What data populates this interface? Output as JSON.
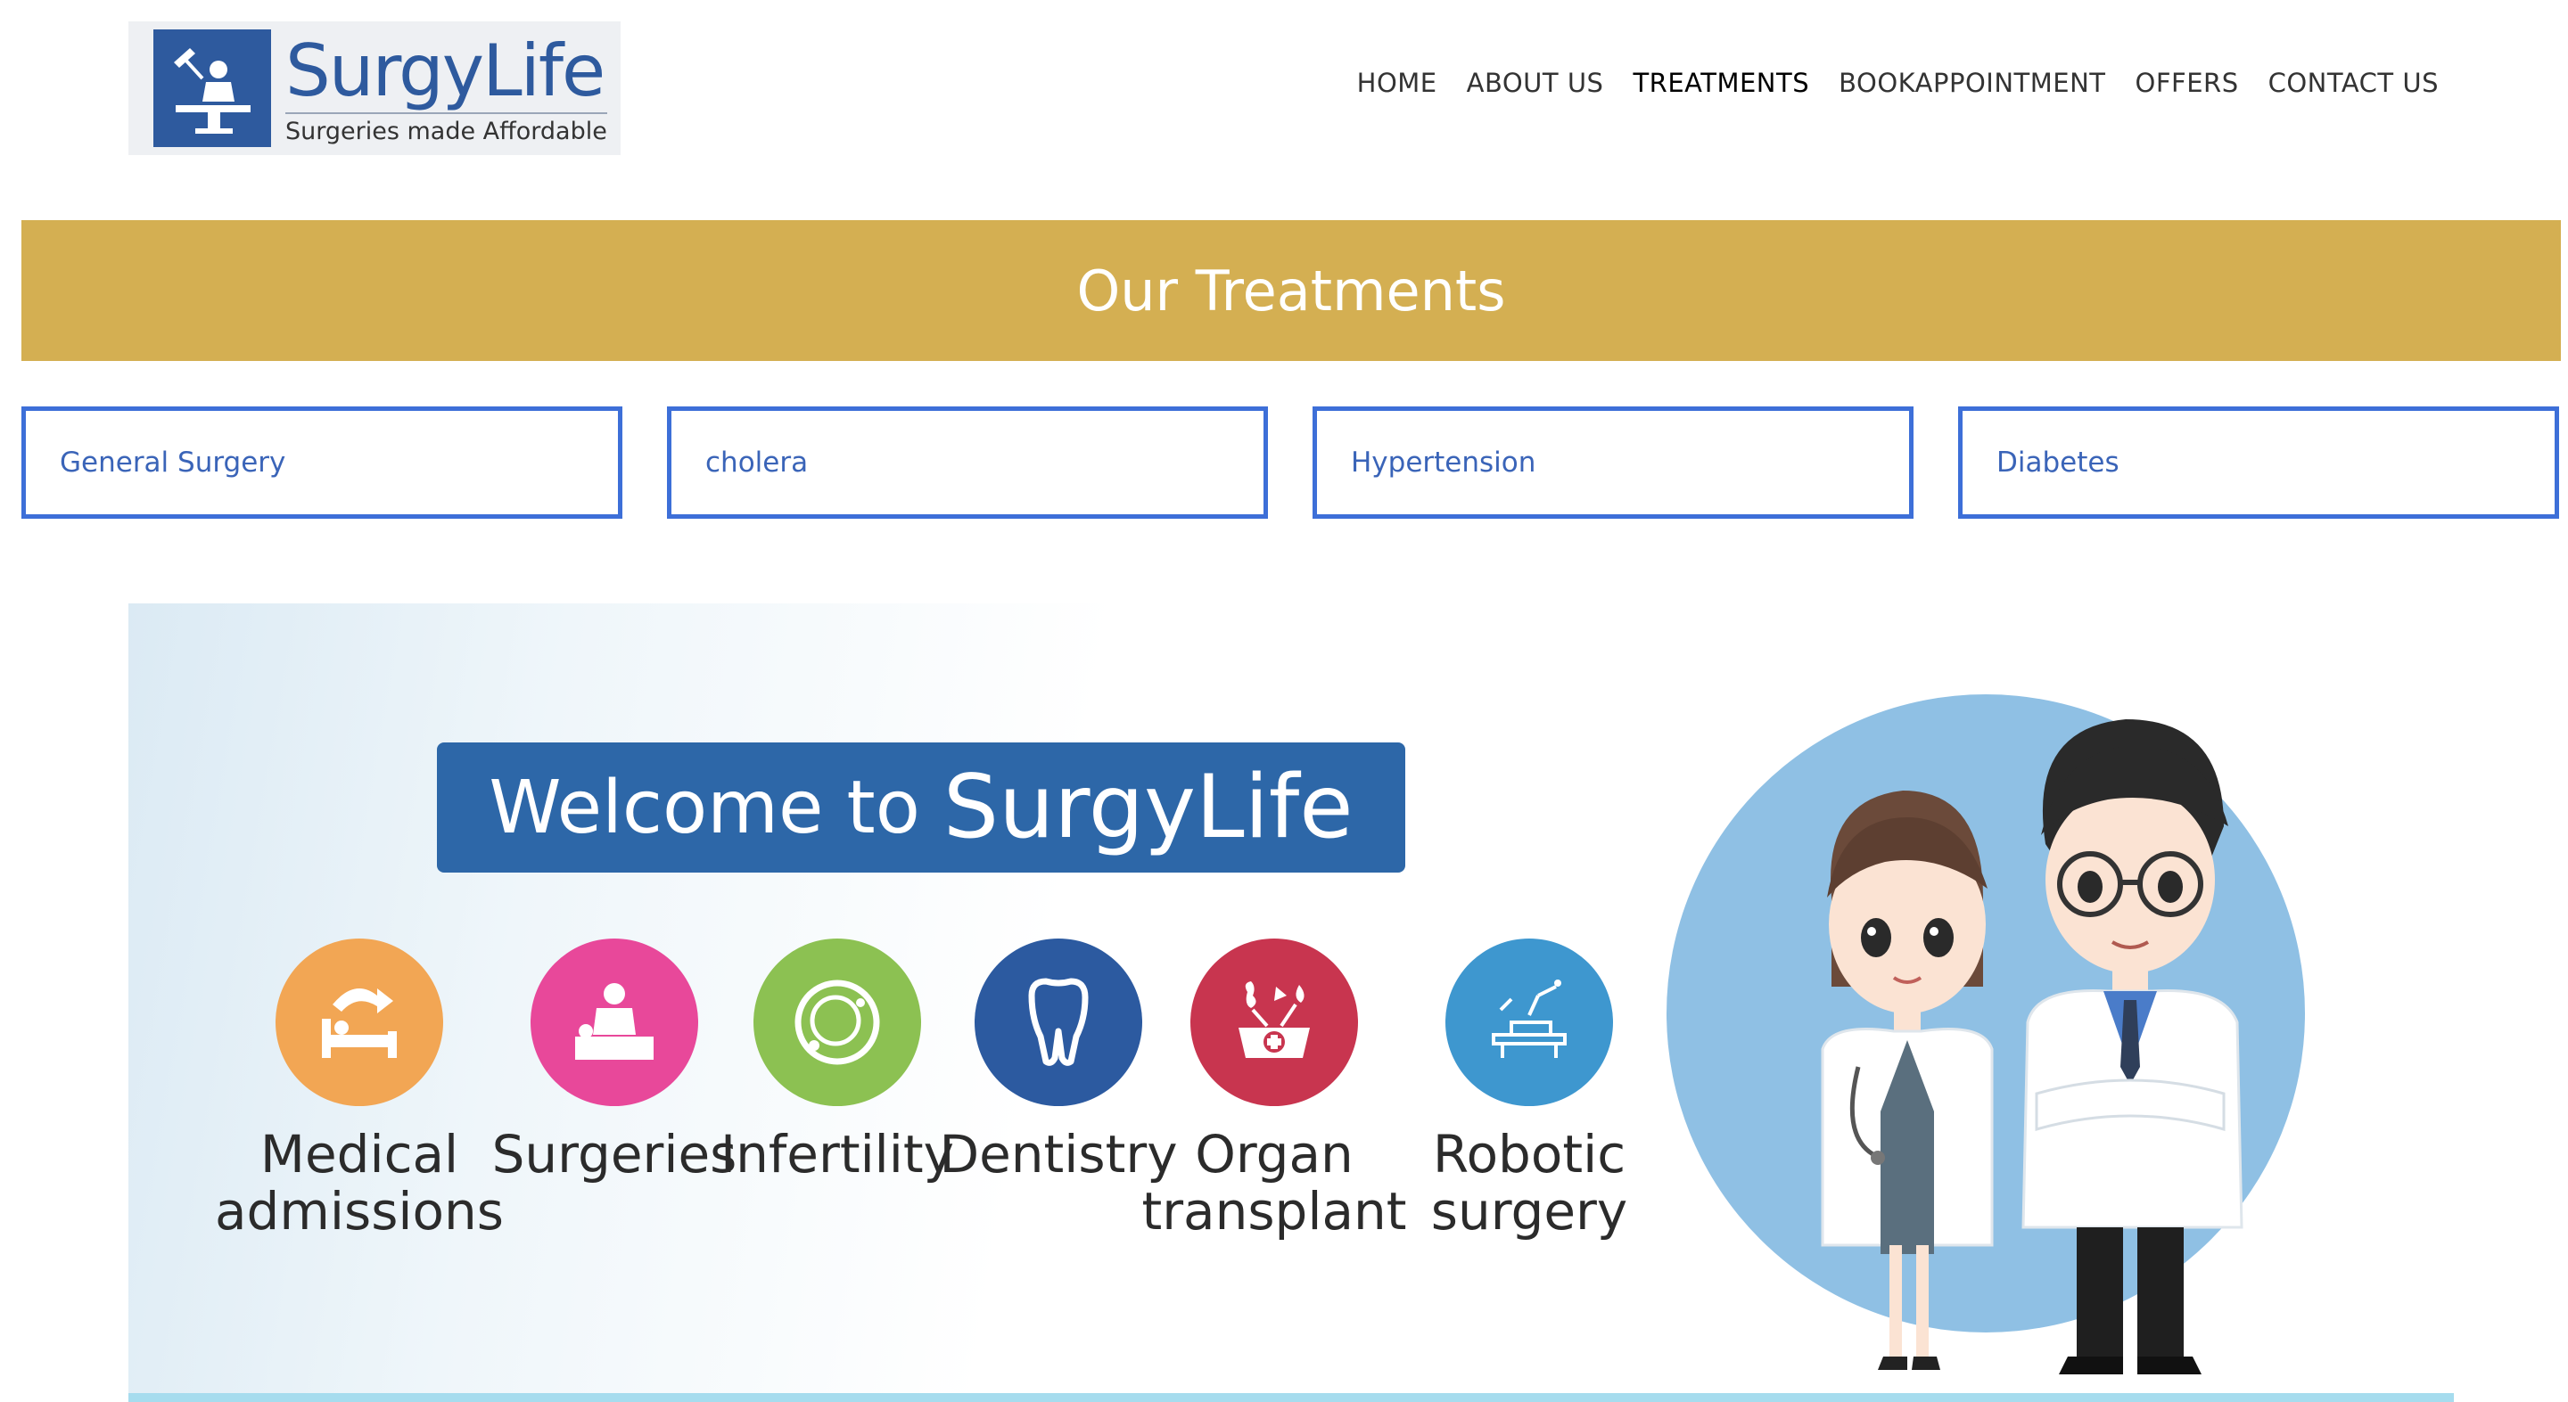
{
  "header": {
    "brand_name": "SurgyLife",
    "brand_tagline": "Surgeries made Affordable",
    "nav": [
      {
        "label": "HOME"
      },
      {
        "label": "ABOUT US"
      },
      {
        "label": "TREATMENTS"
      },
      {
        "label": "BOOKAPPOINTMENT"
      },
      {
        "label": "OFFERS"
      },
      {
        "label": "CONTACT US"
      }
    ],
    "active_nav": "TREATMENTS"
  },
  "banner": {
    "title": "Our Treatments"
  },
  "treatments": [
    {
      "label": "General Surgery"
    },
    {
      "label": "cholera"
    },
    {
      "label": "Hypertension"
    },
    {
      "label": "Diabetes"
    }
  ],
  "hero": {
    "welcome_prefix": "Welcome to",
    "welcome_brand": "SurgyLife",
    "services": [
      {
        "line1": "Medical",
        "line2": "admissions",
        "color": "#f2a654",
        "icon": "bed-icon"
      },
      {
        "line1": "Surgeries",
        "line2": "",
        "color": "#e8489a",
        "icon": "surgeon-icon"
      },
      {
        "line1": "Infertility",
        "line2": "",
        "color": "#8cc152",
        "icon": "cell-icon"
      },
      {
        "line1": "Dentistry",
        "line2": "",
        "color": "#2c5aa0",
        "icon": "tooth-icon"
      },
      {
        "line1": "Organ",
        "line2": "transplant",
        "color": "#c8354f",
        "icon": "organ-box-icon"
      },
      {
        "line1": "Robotic",
        "line2": "surgery",
        "color": "#3e97cf",
        "icon": "robot-arm-icon"
      }
    ]
  },
  "colors": {
    "banner": "#d4af52",
    "treatment_border": "#3d6fd8",
    "brand_blue": "#2e5a9e"
  }
}
